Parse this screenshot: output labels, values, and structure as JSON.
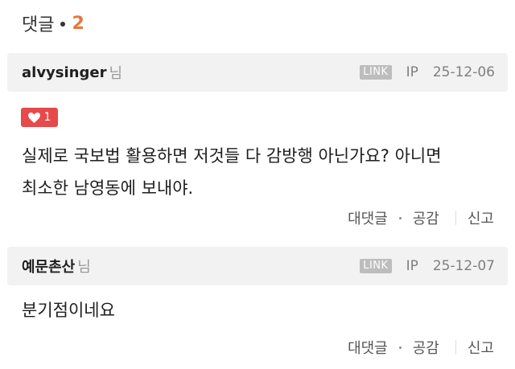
{
  "header": {
    "title": "댓글",
    "count": "2"
  },
  "comments": [
    {
      "author": "alvysinger",
      "suffix": "님",
      "link_label": "LINK",
      "ip_label": "IP",
      "date": "25-12-06",
      "likes": "1",
      "text_line1": "실제로 국보법 활용하면 저것들 다 감방행 아닌가요? 아니면",
      "text_line2": "최소한 남영동에 보내야.",
      "reply_label": "대댓글",
      "agree_label": "공감",
      "report_label": "신고"
    },
    {
      "author": "예문촌산",
      "suffix": "님",
      "link_label": "LINK",
      "ip_label": "IP",
      "date": "25-12-07",
      "text_line1": "분기점이네요",
      "reply_label": "대댓글",
      "agree_label": "공감",
      "report_label": "신고"
    }
  ],
  "colors": {
    "accent": "#e8763a",
    "like": "#e74a4a",
    "bar_bg": "#f2f2f2"
  }
}
